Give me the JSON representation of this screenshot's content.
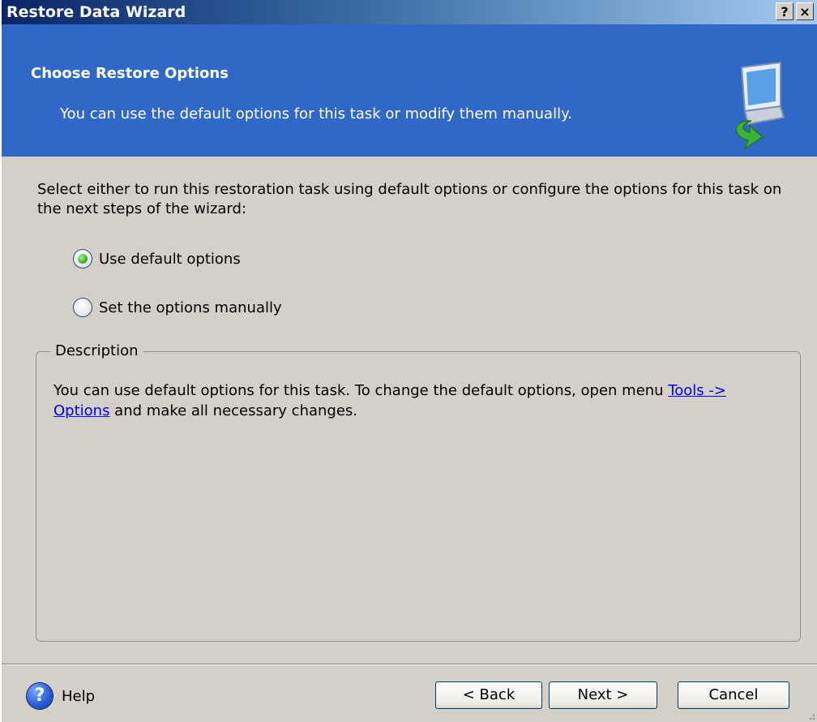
{
  "window": {
    "title": "Restore Data Wizard",
    "help_glyph": "?",
    "close_glyph": "×"
  },
  "header": {
    "title": "Choose Restore Options",
    "subtitle": "You can use the default options for this task or modify them manually.",
    "icon": "computer-restore-icon"
  },
  "body": {
    "intro": "Select either to run this restoration task using default options or configure the options for this task on the next steps of the wizard:",
    "options": [
      {
        "label": "Use default options",
        "selected": true
      },
      {
        "label": "Set the options manually",
        "selected": false
      }
    ]
  },
  "description": {
    "legend": "Description",
    "text_before": "You can use default options for this task. To change the default options, open menu ",
    "link_text": "Tools -> Options",
    "text_after": " and make all necessary changes."
  },
  "footer": {
    "help_label": "Help",
    "back_label": "< Back",
    "next_label": "Next >",
    "cancel_label": "Cancel"
  },
  "colors": {
    "header_bg": "#3068c8",
    "dialog_bg": "#d4d0c8",
    "selected_radio": "#3bb52f"
  }
}
